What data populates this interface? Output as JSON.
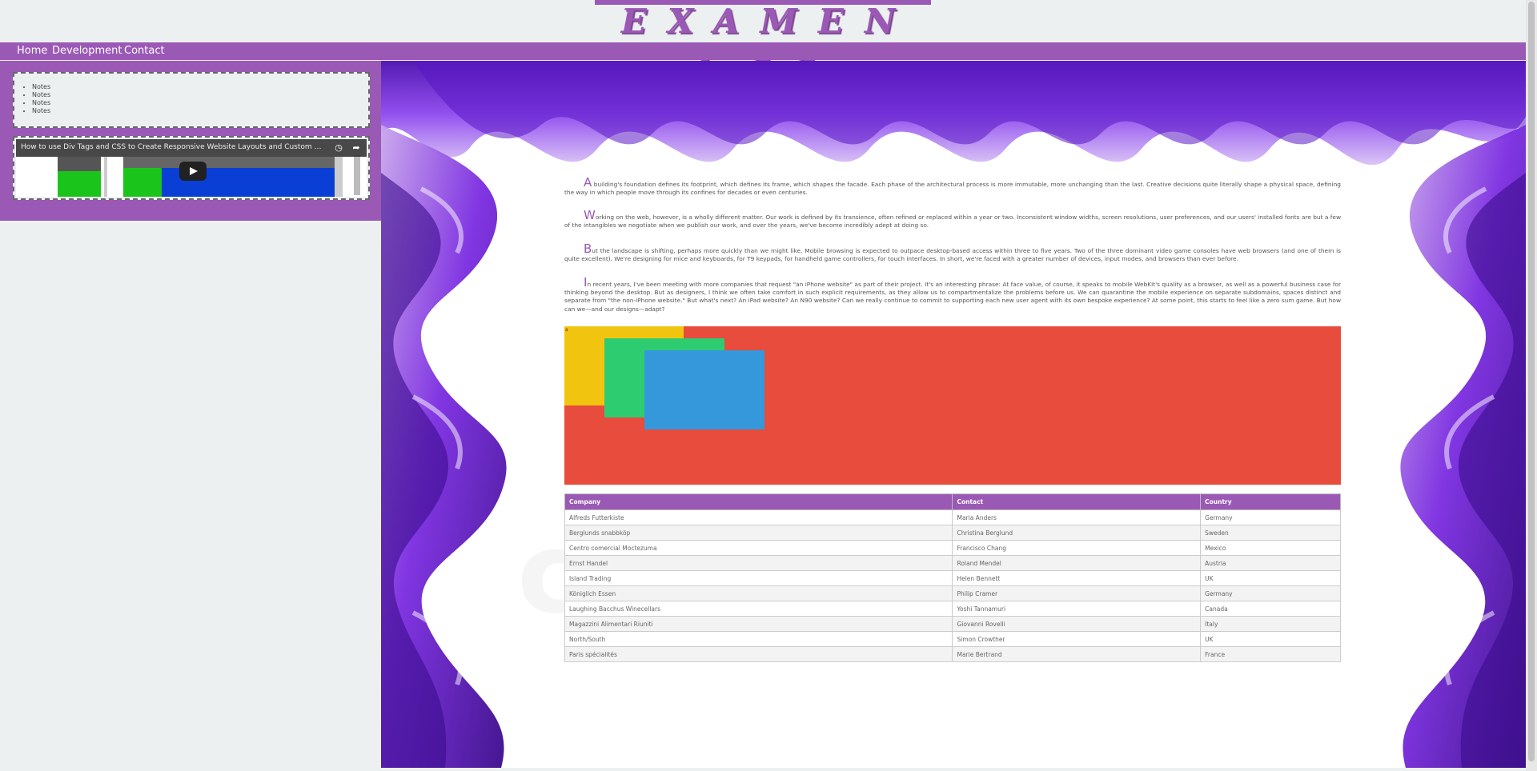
{
  "header": {
    "title": "EXAMEN CSS"
  },
  "nav": {
    "items": [
      "Home",
      "Development",
      "Contact"
    ]
  },
  "sidebar": {
    "notes": [
      "Notes",
      "Notes",
      "Notes",
      "Notes"
    ],
    "video": {
      "title": "How to use Div Tags and CSS to Create Responsive Website Layouts and Custom CSS Menus"
    }
  },
  "main": {
    "paragraphs": [
      {
        "initial": "A",
        "text": " building's foundation defines its footprint, which defines its frame, which shapes the facade. Each phase of the architectural process is more immutable, more unchanging than the last. Creative decisions quite literally shape a physical space, defining the way in which people move through its confines for decades or even centuries."
      },
      {
        "initial": "W",
        "text": "orking on the web, however, is a wholly different matter. Our work is defined by its transience, often refined or replaced within a year or two. Inconsistent window widths, screen resolutions, user preferences, and our users' installed fonts are but a few of the intangibles we negotiate when we publish our work, and over the years, we've become incredibly adept at doing so."
      },
      {
        "initial": "B",
        "text": "ut the landscape is shifting, perhaps more quickly than we might like. Mobile browsing is expected to outpace desktop-based access within three to five years. Two of the three dominant video game consoles have web browsers (and one of them is quite excellent). We're designing for mice and keyboards, for T9 keypads, for handheld game controllers, for touch interfaces. In short, we're faced with a greater number of devices, input modes, and browsers than ever before."
      },
      {
        "initial": "I",
        "text": "n recent years, I've been meeting with more companies that request \"an iPhone website\" as part of their project. It's an interesting phrase: At face value, of course, it speaks to mobile WebKit's quality as a browser, as well as a powerful business case for thinking beyond the desktop. But as designers, I think we often take comfort in such explicit requirements, as they allow us to compartmentalize the problems before us. We can quarantine the mobile experience on separate subdomains, spaces distinct and separate from \"the non-iPhone website.\" But what's next? An iPad website? An N90 website? Can we really continue to commit to supporting each new user agent with its own bespoke experience? At some point, this starts to feel like a zero sum game. But how can we—and our designs—adapt?"
      }
    ],
    "red_label": "a",
    "watermark": "colourbox",
    "table": {
      "headers": [
        "Company",
        "Contact",
        "Country"
      ],
      "rows": [
        [
          "Alfreds Futterkiste",
          "Maria Anders",
          "Germany"
        ],
        [
          "Berglunds snabbköp",
          "Christina Berglund",
          "Sweden"
        ],
        [
          "Centro comercial Moctezuma",
          "Francisco Chang",
          "Mexico"
        ],
        [
          "Ernst Handel",
          "Roland Mendel",
          "Austria"
        ],
        [
          "Island Trading",
          "Helen Bennett",
          "UK"
        ],
        [
          "Königlich Essen",
          "Philip Cramer",
          "Germany"
        ],
        [
          "Laughing Bacchus Winecellars",
          "Yoshi Tannamuri",
          "Canada"
        ],
        [
          "Magazzini Alimentari Riuniti",
          "Giovanni Rovelli",
          "Italy"
        ],
        [
          "North/South",
          "Simon Crowther",
          "UK"
        ],
        [
          "Paris spécialités",
          "Marie Bertrand",
          "France"
        ]
      ]
    }
  },
  "colors": {
    "accent": "#9b59b6",
    "red": "#e74c3c",
    "yellow": "#f1c40f",
    "green": "#2ecc71",
    "blue": "#3498db",
    "background": "#ecf0f1"
  }
}
